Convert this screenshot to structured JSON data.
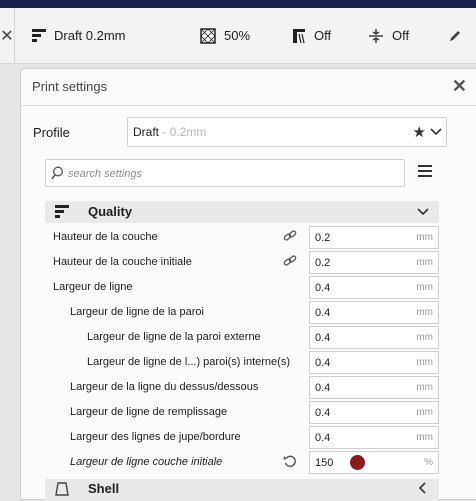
{
  "toolbar": {
    "profile_label": "Draft 0.2mm",
    "infill_label": "50%",
    "support_label": "Off",
    "adhesion_label": "Off"
  },
  "panel": {
    "title": "Print settings",
    "profile_label": "Profile",
    "profile_name": "Draft",
    "profile_suffix": " - 0.2mm",
    "search_placeholder": "search settings"
  },
  "category": {
    "label": "Quality",
    "next_label": "Shell"
  },
  "rows": [
    {
      "label": "Hauteur de la couche",
      "value": "0.2",
      "unit": "mm",
      "icon": "link-icon"
    },
    {
      "label": "Hauteur de la couche initiale",
      "value": "0.2",
      "unit": "mm",
      "icon": "link-icon"
    },
    {
      "label": "Largeur de ligne",
      "value": "0.4",
      "unit": "mm"
    },
    {
      "label": "Largeur de ligne de la paroi",
      "value": "0.4",
      "unit": "mm"
    },
    {
      "label": "Largeur de ligne de la paroi externe",
      "value": "0.4",
      "unit": "mm"
    },
    {
      "label": "Largeur de ligne de l...) paroi(s) interne(s)",
      "value": "0.4",
      "unit": "mm"
    },
    {
      "label": "Largeur de la ligne du dessus/dessous",
      "value": "0.4",
      "unit": "mm"
    },
    {
      "label": "Largeur de ligne de remplissage",
      "value": "0.4",
      "unit": "mm"
    },
    {
      "label": "Largeur des lignes de jupe/bordure",
      "value": "0.4",
      "unit": "mm"
    },
    {
      "label": "Largeur de ligne couche initiale",
      "value": "150",
      "unit": "%",
      "icon": "reset-icon"
    }
  ]
}
